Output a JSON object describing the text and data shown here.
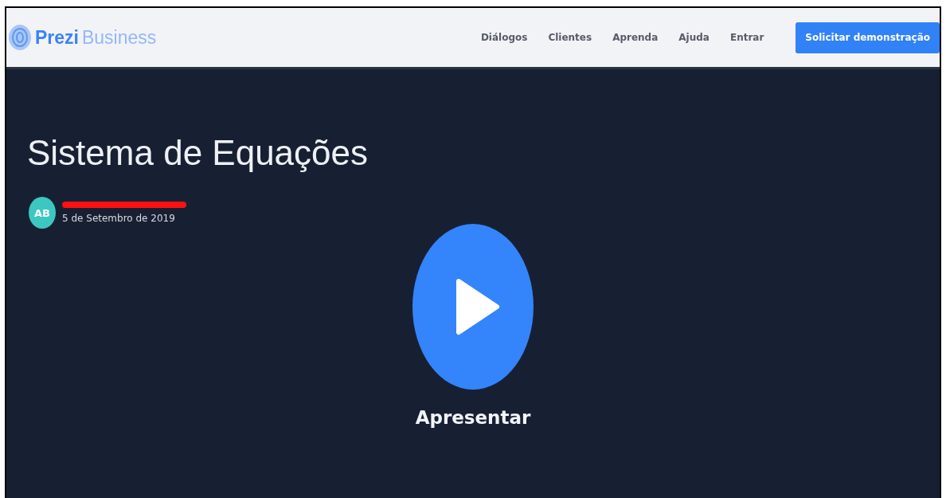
{
  "header": {
    "logo": {
      "brand": "Prezi",
      "product": "Business"
    },
    "nav": [
      "Diálogos",
      "Clientes",
      "Aprenda",
      "Ajuda",
      "Entrar"
    ],
    "cta": "Solicitar demonstração"
  },
  "presentation": {
    "title": "Sistema de Equações",
    "author": {
      "initials": "AB",
      "name_redacted": true,
      "date": "5 de Setembro de 2019"
    },
    "play_label": "Apresentar"
  }
}
